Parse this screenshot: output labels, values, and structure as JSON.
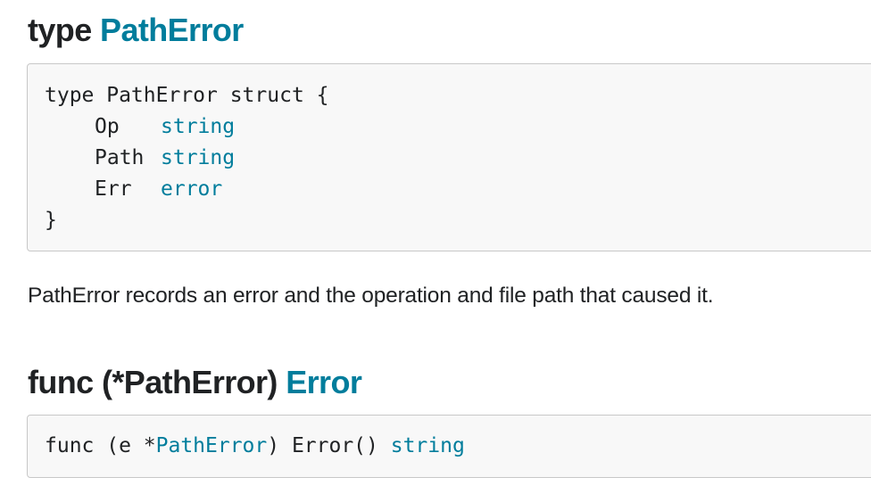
{
  "sections": [
    {
      "heading_keyword": "type",
      "heading_name": "PathError",
      "code": {
        "decl_start": "type PathError struct {",
        "fields": [
          {
            "name": "Op",
            "type": "string"
          },
          {
            "name": "Path",
            "type": "string"
          },
          {
            "name": "Err",
            "type": "error"
          }
        ],
        "decl_end": "}"
      },
      "description": "PathError records an error and the operation and file path that caused it."
    },
    {
      "heading_keyword": "func (*PathError)",
      "heading_name": "Error",
      "code": {
        "prefix": "func (e *",
        "receiver_type": "PathError",
        "middle": ") Error() ",
        "return_type": "string"
      }
    }
  ],
  "colors": {
    "link": "#007d9c",
    "text": "#202224",
    "code_bg": "#f8f8f8",
    "code_border": "#c8c8c8"
  }
}
